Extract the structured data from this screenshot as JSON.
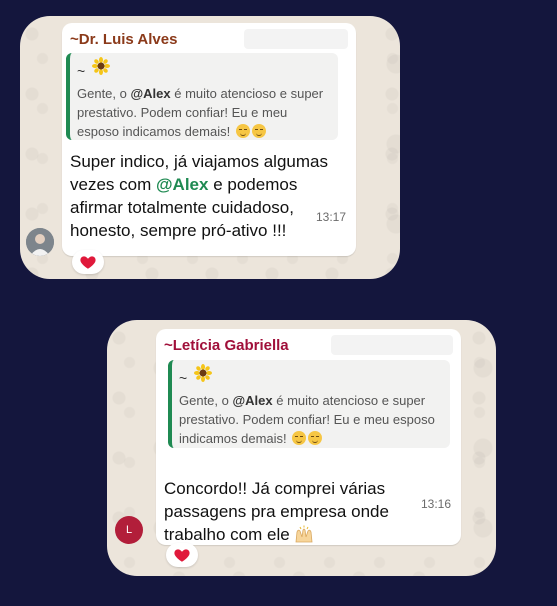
{
  "messages": [
    {
      "sender": "~Dr. Luis Alves",
      "sender_color": "#8b3a1a",
      "quote": {
        "author": "~",
        "mention": "@Alex",
        "text_before": "Gente, o ",
        "text_after": " é muito atencioso e super prestativo. Podem confiar! Eu e meu esposo indicamos demais!"
      },
      "body_before": "Super indico, já viajamos algumas vezes com ",
      "body_mention": "@Alex",
      "body_after": " e podemos afirmar totalmente cuidadoso, honesto, sempre pró-ativo !!!",
      "time": "13:17",
      "avatar": "photo",
      "reaction": "heart"
    },
    {
      "sender": "~Letícia Gabriella",
      "sender_color": "#a0103a",
      "quote": {
        "author": "~",
        "mention": "@Alex",
        "text_before": "Gente, o ",
        "text_after": " é muito atencioso e super prestativo. Podem confiar! Eu e meu esposo indicamos demais!"
      },
      "body": "Concordo!! Já comprei várias passagens pra empresa onde trabalho com ele",
      "time": "13:16",
      "avatar_initial": "L",
      "reaction": "heart"
    }
  ]
}
